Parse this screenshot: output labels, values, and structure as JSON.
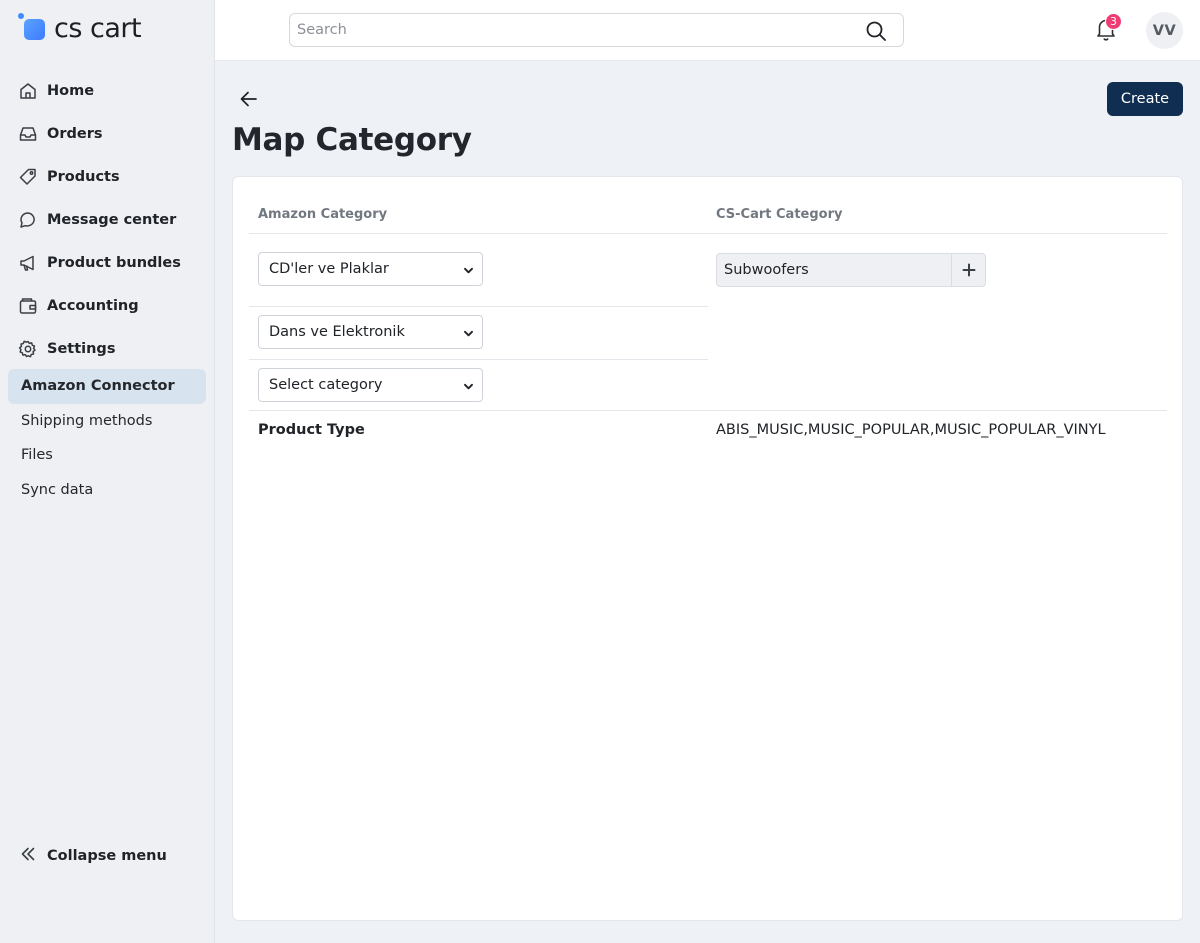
{
  "brand": {
    "logo_text": "cs cart",
    "accent": "#3f7bff"
  },
  "sidebar": {
    "items": [
      {
        "label": "Home",
        "icon": "home-icon"
      },
      {
        "label": "Orders",
        "icon": "inbox-icon"
      },
      {
        "label": "Products",
        "icon": "tag-icon"
      },
      {
        "label": "Message center",
        "icon": "chat-icon"
      },
      {
        "label": "Product bundles",
        "icon": "megaphone-icon"
      },
      {
        "label": "Accounting",
        "icon": "wallet-icon"
      },
      {
        "label": "Settings",
        "icon": "gear-icon"
      }
    ],
    "subitems": [
      {
        "label": "Amazon Connector",
        "active": true
      },
      {
        "label": "Shipping methods",
        "active": false
      },
      {
        "label": "Files",
        "active": false
      },
      {
        "label": "Sync data",
        "active": false
      }
    ],
    "collapse_label": "Collapse menu"
  },
  "header": {
    "search_placeholder": "Search",
    "notifications_count": "3",
    "avatar_initials": "VV"
  },
  "page": {
    "title": "Map Category",
    "create_label": "Create"
  },
  "mapping": {
    "amazon_header": "Amazon Category",
    "cscart_header": "CS-Cart Category",
    "selects": [
      {
        "value": "CD'ler ve Plaklar"
      },
      {
        "value": "Dans ve Elektronik"
      },
      {
        "value": "Select category"
      }
    ],
    "cscart_value": "Subwoofers",
    "product_type_label": "Product Type",
    "product_type_value": "ABIS_MUSIC,MUSIC_POPULAR,MUSIC_POPULAR_VINYL"
  },
  "colors": {
    "primary_button": "#102e52",
    "badge": "#ee3d73",
    "active_nav_bg": "#d8e3f0"
  }
}
